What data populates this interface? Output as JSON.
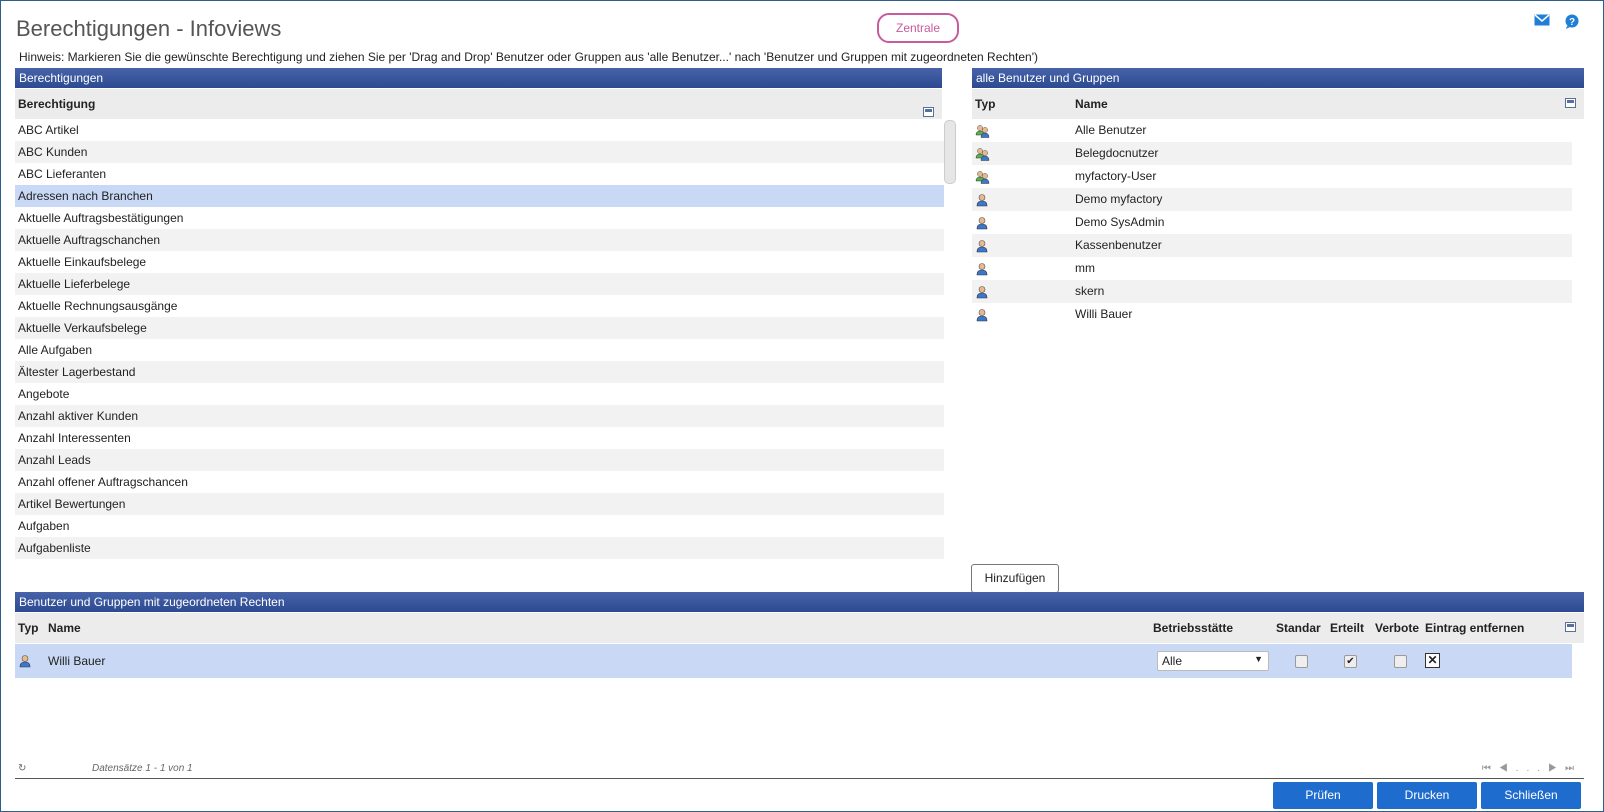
{
  "page": {
    "title": "Berechtigungen - Infoviews",
    "zentrale": "Zentrale",
    "hint": "Hinweis: Markieren Sie die gewünschte Berechtigung und ziehen Sie per 'Drag and Drop' Benutzer oder Gruppen aus 'alle Benutzer...' nach 'Benutzer und Gruppen mit zugeordneten Rechten')"
  },
  "perm": {
    "header": "Berechtigungen",
    "column": "Berechtigung",
    "items": [
      "ABC Artikel",
      "ABC Kunden",
      "ABC Lieferanten",
      "Adressen nach Branchen",
      "Aktuelle Auftragsbestätigungen",
      "Aktuelle Auftragschanchen",
      "Aktuelle Einkaufsbelege",
      "Aktuelle Lieferbelege",
      "Aktuelle Rechnungsausgänge",
      "Aktuelle Verkaufsbelege",
      "Alle Aufgaben",
      "Ältester Lagerbestand",
      "Angebote",
      "Anzahl aktiver Kunden",
      "Anzahl Interessenten",
      "Anzahl Leads",
      "Anzahl offener Auftragschancen",
      "Artikel Bewertungen",
      "Aufgaben",
      "Aufgabenliste"
    ],
    "selected_index": 3
  },
  "users": {
    "header": "alle Benutzer und Gruppen",
    "col_typ": "Typ",
    "col_name": "Name",
    "items": [
      {
        "name": "Alle Benutzer",
        "type": "group"
      },
      {
        "name": "Belegdocnutzer",
        "type": "group"
      },
      {
        "name": "myfactory-User",
        "type": "group"
      },
      {
        "name": "Demo myfactory",
        "type": "user"
      },
      {
        "name": "Demo SysAdmin",
        "type": "user"
      },
      {
        "name": "Kassenbenutzer",
        "type": "user"
      },
      {
        "name": "mm",
        "type": "user"
      },
      {
        "name": "skern",
        "type": "user"
      },
      {
        "name": "Willi Bauer",
        "type": "user"
      }
    ]
  },
  "add_button": "Hinzufügen",
  "assigned": {
    "header": "Benutzer und Gruppen mit zugeordneten Rechten",
    "col_typ": "Typ",
    "col_name": "Name",
    "col_betrieb": "Betriebsstätte",
    "col_standard": "Standar",
    "col_erteilt": "Erteilt",
    "col_verbote": "Verbote",
    "col_remove": "Eintrag entfernen",
    "row": {
      "name": "Willi Bauer",
      "betrieb": "Alle",
      "standard": false,
      "erteilt": true,
      "verbote": false
    }
  },
  "footer": {
    "records": "Datensätze 1 - 1 von 1",
    "pager_ellipsis": "..."
  },
  "buttons": {
    "pruefen": "Prüfen",
    "drucken": "Drucken",
    "schliessen": "Schließen"
  },
  "colors": {
    "header_blue": "#2c4a92",
    "button_blue": "#1f6ccf",
    "accent_pink": "#c75b9b",
    "selected_row": "#c9d9f5"
  }
}
